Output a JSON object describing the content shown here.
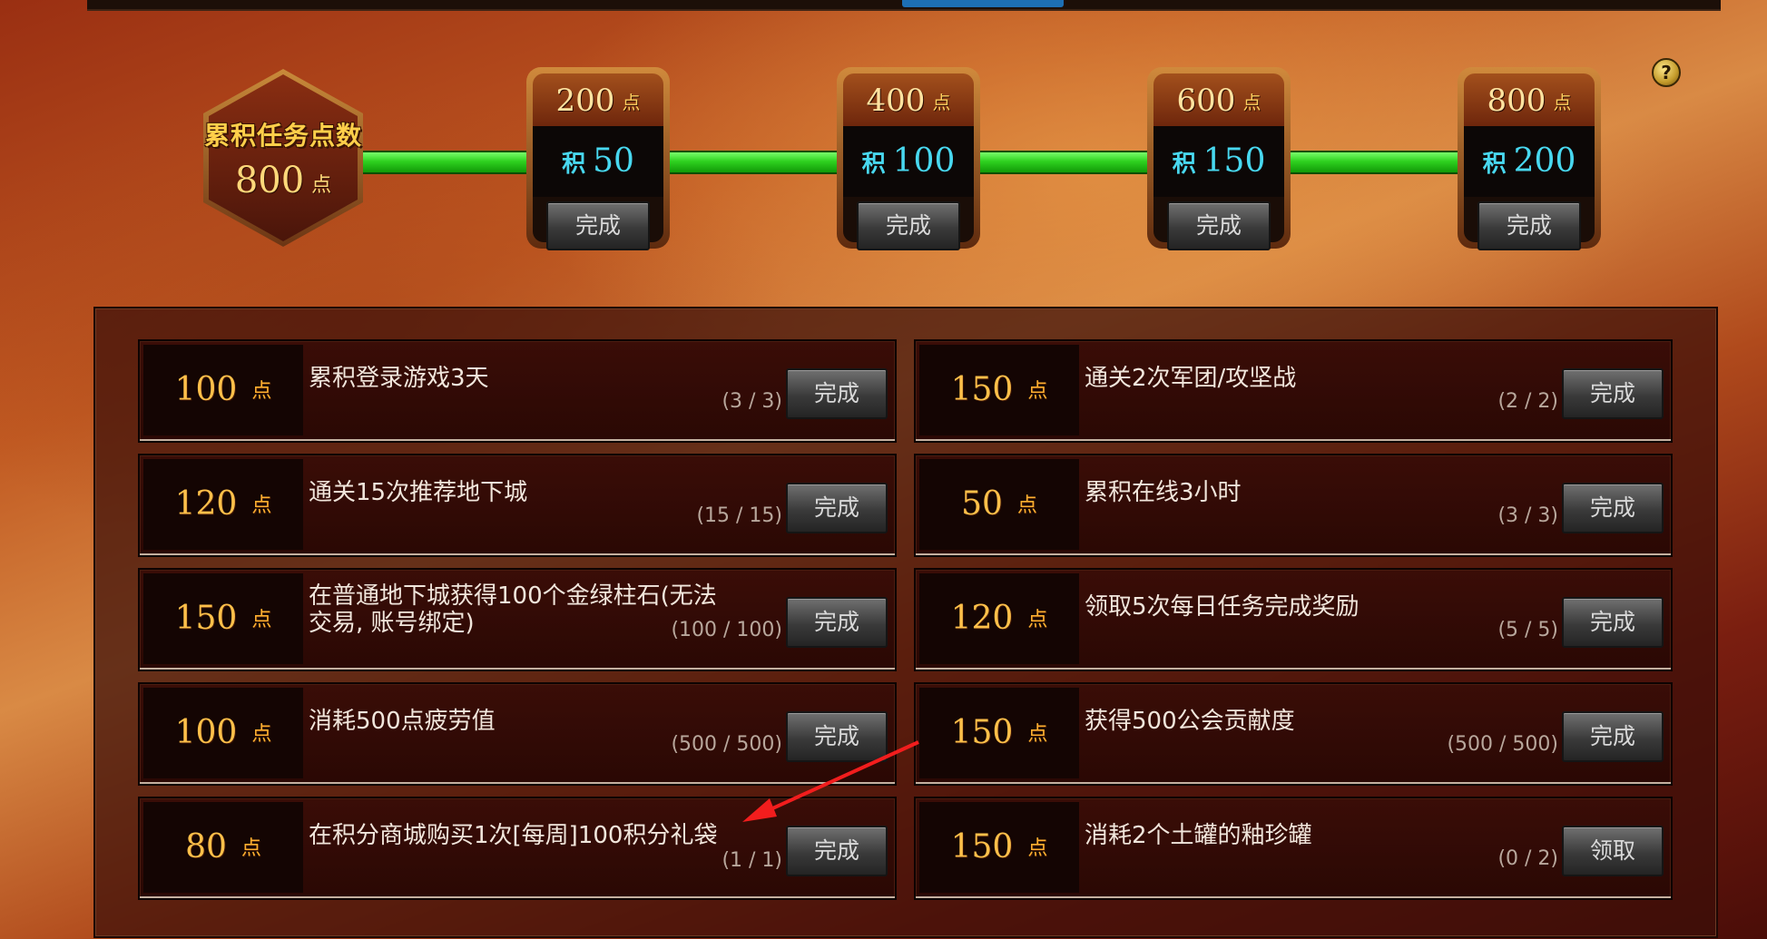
{
  "header": {
    "total_title": "累积任务点数",
    "total_value": "800",
    "point_unit": "点",
    "help_label": "?"
  },
  "milestones": [
    {
      "points": "200",
      "reward_prefix": "积",
      "reward": "50",
      "button": "完成"
    },
    {
      "points": "400",
      "reward_prefix": "积",
      "reward": "100",
      "button": "完成"
    },
    {
      "points": "600",
      "reward_prefix": "积",
      "reward": "150",
      "button": "完成"
    },
    {
      "points": "800",
      "reward_prefix": "积",
      "reward": "200",
      "button": "完成"
    }
  ],
  "tasks": [
    {
      "points": "100",
      "desc": "累积登录游戏3天",
      "progress": "(3 / 3)",
      "button": "完成"
    },
    {
      "points": "150",
      "desc": "通关2次军团/攻坚战",
      "progress": "(2 / 2)",
      "button": "完成"
    },
    {
      "points": "120",
      "desc": "通关15次推荐地下城",
      "progress": "(15 / 15)",
      "button": "完成"
    },
    {
      "points": "50",
      "desc": "累积在线3小时",
      "progress": "(3 / 3)",
      "button": "完成"
    },
    {
      "points": "150",
      "desc": "在普通地下城获得100个金绿柱石(无法交易, 账号绑定)",
      "progress": "(100 / 100)",
      "button": "完成"
    },
    {
      "points": "120",
      "desc": "领取5次每日任务完成奖励",
      "progress": "(5 / 5)",
      "button": "完成"
    },
    {
      "points": "100",
      "desc": "消耗500点疲劳值",
      "progress": "(500 / 500)",
      "button": "完成"
    },
    {
      "points": "150",
      "desc": "获得500公会贡献度",
      "progress": "(500 / 500)",
      "button": "完成"
    },
    {
      "points": "80",
      "desc": "在积分商城购买1次[每周]100积分礼袋",
      "progress": "(1 / 1)",
      "button": "完成"
    },
    {
      "points": "150",
      "desc": "消耗2个土罐的釉珍罐",
      "progress": "(0 / 2)",
      "button": "领取"
    }
  ]
}
